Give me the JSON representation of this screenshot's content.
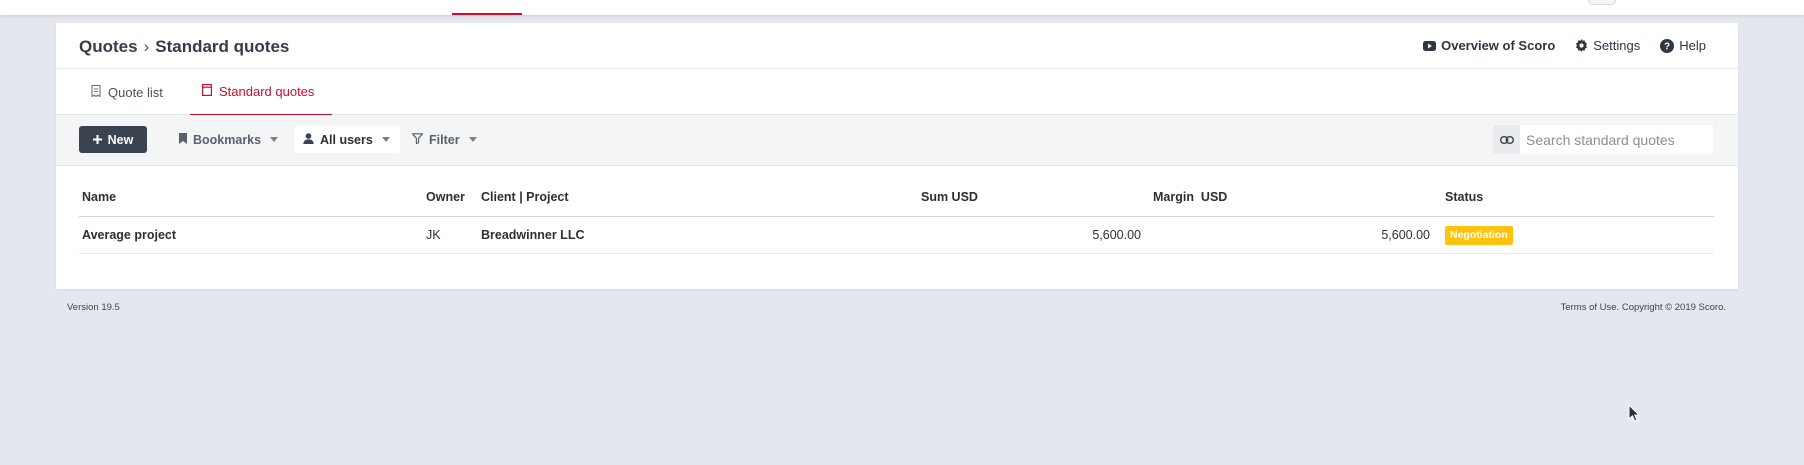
{
  "breadcrumb": {
    "parent": "Quotes",
    "separator": "›",
    "current": "Standard quotes"
  },
  "header_links": {
    "overview": "Overview of Scoro",
    "settings": "Settings",
    "help": "Help"
  },
  "tabs": [
    {
      "label": "Quote list",
      "active": false
    },
    {
      "label": "Standard quotes",
      "active": true
    }
  ],
  "toolbar": {
    "new_label": "New",
    "bookmarks_label": "Bookmarks",
    "users_label": "All users",
    "filter_label": "Filter",
    "search_placeholder": "Search standard quotes",
    "search_value": ""
  },
  "table": {
    "columns": {
      "name": "Name",
      "owner": "Owner",
      "client": "Client | Project",
      "sum": "Sum USD",
      "margin": "Margin  USD",
      "status": "Status"
    },
    "rows": [
      {
        "name": "Average project",
        "owner": "JK",
        "client": "Breadwinner LLC",
        "sum": "5,600.00",
        "margin": "5,600.00",
        "status": "Negotiation"
      }
    ]
  },
  "footer": {
    "version": "Version 19.5",
    "copyright": "Terms of Use. Copyright © 2019 Scoro."
  },
  "colors": {
    "accent": "#c8102e",
    "primary_button": "#3b4350",
    "status_negotiation": "#ffc20e",
    "background": "#e4e7ee"
  },
  "icons": {
    "overview": "youtube-play-icon",
    "settings": "gear-icon",
    "help": "question-circle-icon",
    "quote_list": "receipt-icon",
    "standard_quotes": "document-icon",
    "new": "plus-icon",
    "bookmarks": "bookmark-icon",
    "users": "user-icon",
    "filter": "filter-icon",
    "link": "link-icon"
  }
}
